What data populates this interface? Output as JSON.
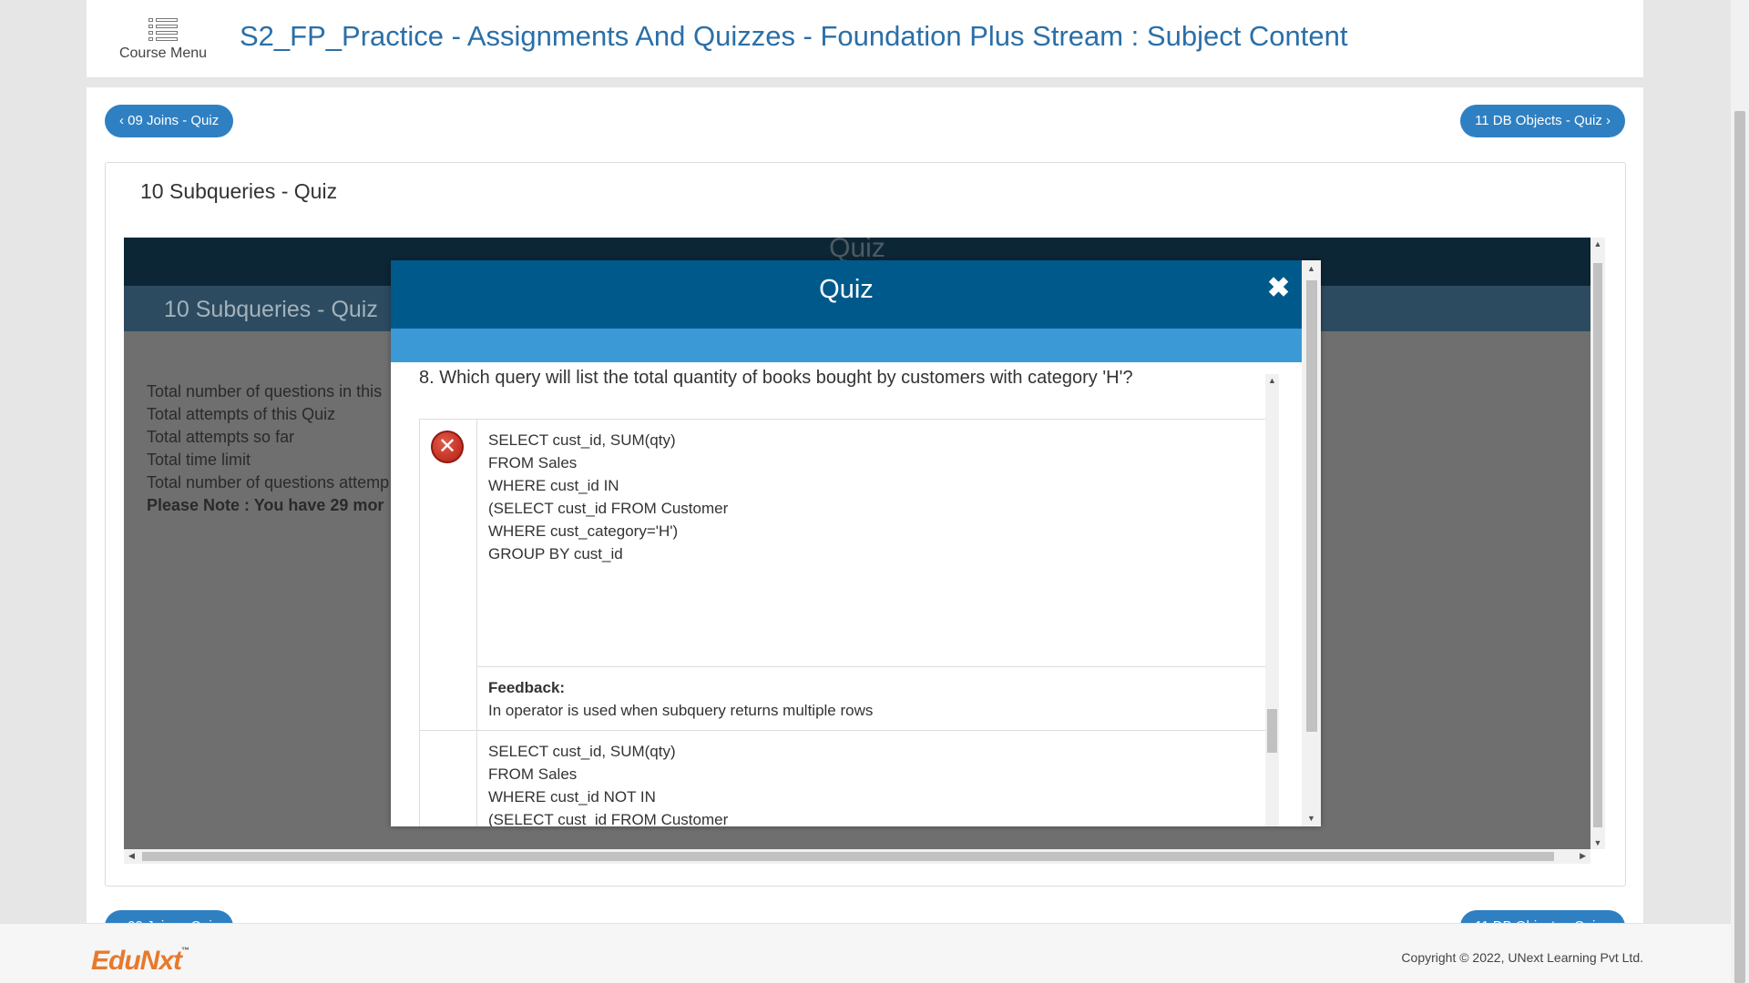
{
  "header": {
    "course_menu_label": "Course Menu",
    "title": "S2_FP_Practice - Assignments And Quizzes - Foundation Plus Stream : Subject Content"
  },
  "nav": {
    "prev_label": "‹ 09 Joins - Quiz",
    "next_label": "11 DB Objects - Quiz ›"
  },
  "content": {
    "title": "10 Subqueries - Quiz",
    "frame_top_title": "Quiz",
    "frame_sub_title": "10 Subqueries - Quiz",
    "info_lines": [
      "Total number of questions in this",
      "Total attempts of this Quiz",
      "Total attempts so far",
      "Total time limit",
      "Total number of questions attemp"
    ],
    "note": "Please Note : You have 29 mor"
  },
  "modal": {
    "title": "Quiz",
    "close_symbol": "✖",
    "question": "8. Which query will list the total quantity of books bought by customers with category 'H'?",
    "answers": [
      {
        "status": "wrong",
        "status_symbol": "✕",
        "code": "SELECT cust_id, SUM(qty)\nFROM Sales\nWHERE cust_id IN\n(SELECT cust_id FROM Customer\nWHERE cust_category='H')\nGROUP BY cust_id",
        "feedback_label": "Feedback:",
        "feedback_text": "In operator is used when subquery returns multiple rows"
      },
      {
        "status": "none",
        "code": "SELECT cust_id, SUM(qty)\nFROM Sales\nWHERE cust_id NOT IN\n(SELECT cust_id FROM Customer"
      }
    ]
  },
  "footer": {
    "logo_text": "EduNxt",
    "logo_tm": "™",
    "copyright": "Copyright © 2022, UNext Learning Pvt Ltd."
  },
  "colors": {
    "title_blue": "#2a6fa8",
    "button_blue": "#2f80c2",
    "modal_header": "#00598b",
    "modal_band": "#3b9ad6",
    "wrong_red": "#c0392b",
    "logo_orange": "#e8792b"
  }
}
